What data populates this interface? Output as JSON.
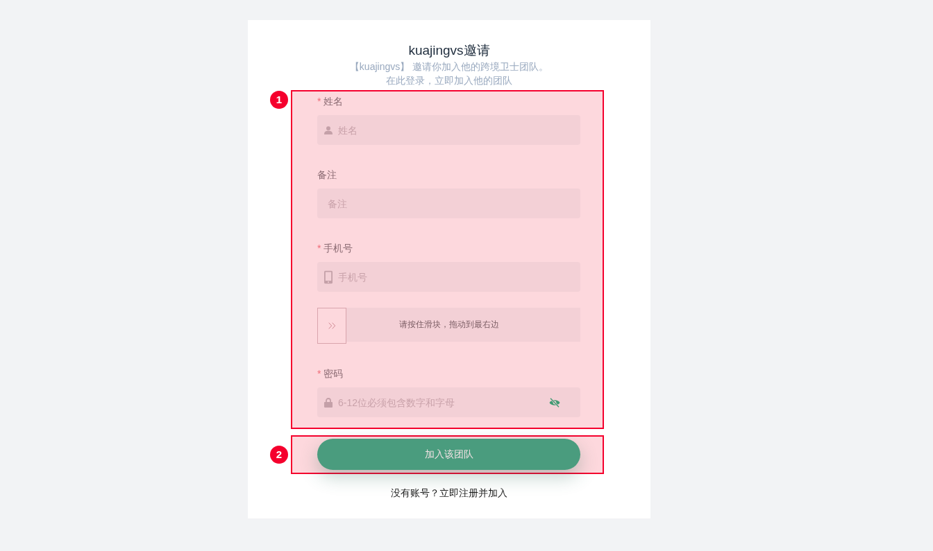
{
  "header": {
    "title": "kuajingvs邀请",
    "subtitle_lines": [
      "【kuajingvs】 邀请你加入他的跨境卫士团队。",
      "在此登录，立即加入他的团队"
    ]
  },
  "form_section": {
    "marker": "1",
    "fields": [
      {
        "kind": "name",
        "label": "姓名",
        "required_mark": "*",
        "placeholder": "姓名"
      },
      {
        "kind": "note",
        "label": "备注",
        "placeholder": "备注"
      },
      {
        "kind": "phone",
        "label": "手机号",
        "required_mark": "*",
        "placeholder": "手机号"
      },
      {
        "kind": "captcha",
        "hint": "请按住滑块，拖动到最右边",
        "level": 0
      },
      {
        "kind": "password",
        "label": "密码",
        "required_mark": "*",
        "placeholder": "6-12位必须包含数字和字母",
        "password_visible": false
      }
    ]
  },
  "submit_section": {
    "marker": "2",
    "button": "加入该团队"
  },
  "footer": {
    "prompt": "没有账号？",
    "link": "立即注册并加入"
  }
}
